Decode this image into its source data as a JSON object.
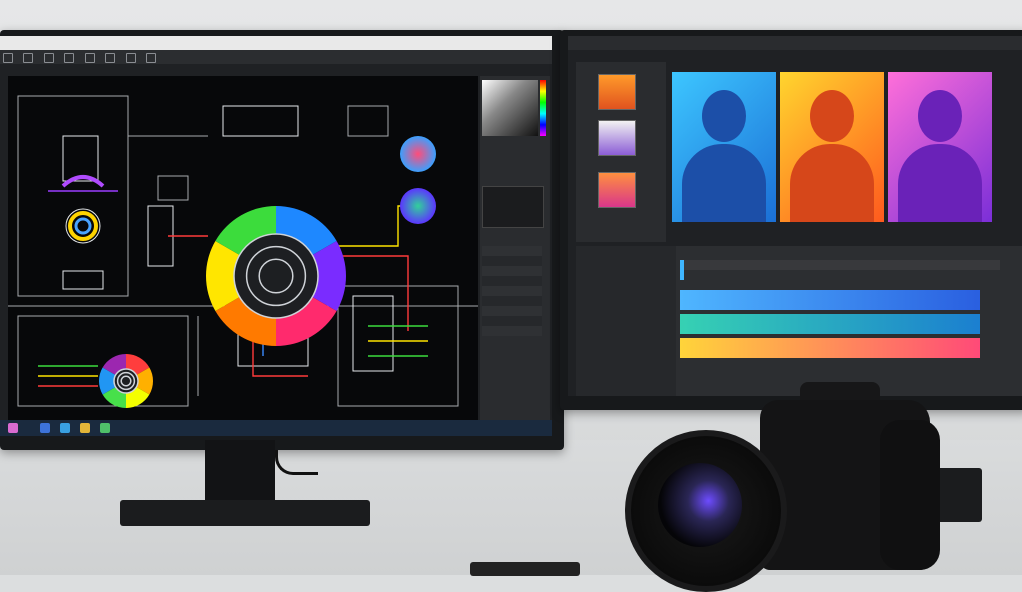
{
  "scene": {
    "description_free": true
  },
  "left_monitor": {
    "titlebar_text": "",
    "wheels": [
      {
        "colors": [
          "#1e88ff",
          "#7a2cff",
          "#ff2a6d",
          "#ff7a00",
          "#ffe600",
          "#3cdc3c"
        ]
      },
      {
        "colors": [
          "#ff3d3d",
          "#ffb000",
          "#f4ff00",
          "#47e04a",
          "#2196f3",
          "#9c27b0"
        ]
      }
    ],
    "orbs": [
      {
        "from": "#ff4d7a",
        "to": "#3aa0ff"
      },
      {
        "from": "#31d19a",
        "to": "#5b35ff"
      }
    ]
  },
  "right_monitor": {
    "titlebar_text": "",
    "portraits": [
      {
        "bg_from": "#3dc6ff",
        "bg_to": "#1b6fd6",
        "fig": "#1c4fa8"
      },
      {
        "bg_from": "#ffd52e",
        "bg_to": "#ff5a1e",
        "fig": "#d6471a"
      },
      {
        "bg_from": "#ff6fd9",
        "bg_to": "#7b2fd8",
        "fig": "#6a22b8"
      }
    ],
    "timeline_bars": [
      {
        "from": "#4fb6ff",
        "to": "#2a5fe0"
      },
      {
        "from": "#36d1b3",
        "to": "#1b7fd0"
      },
      {
        "from": "#ffd43a",
        "to": "#ff4a78"
      }
    ]
  }
}
